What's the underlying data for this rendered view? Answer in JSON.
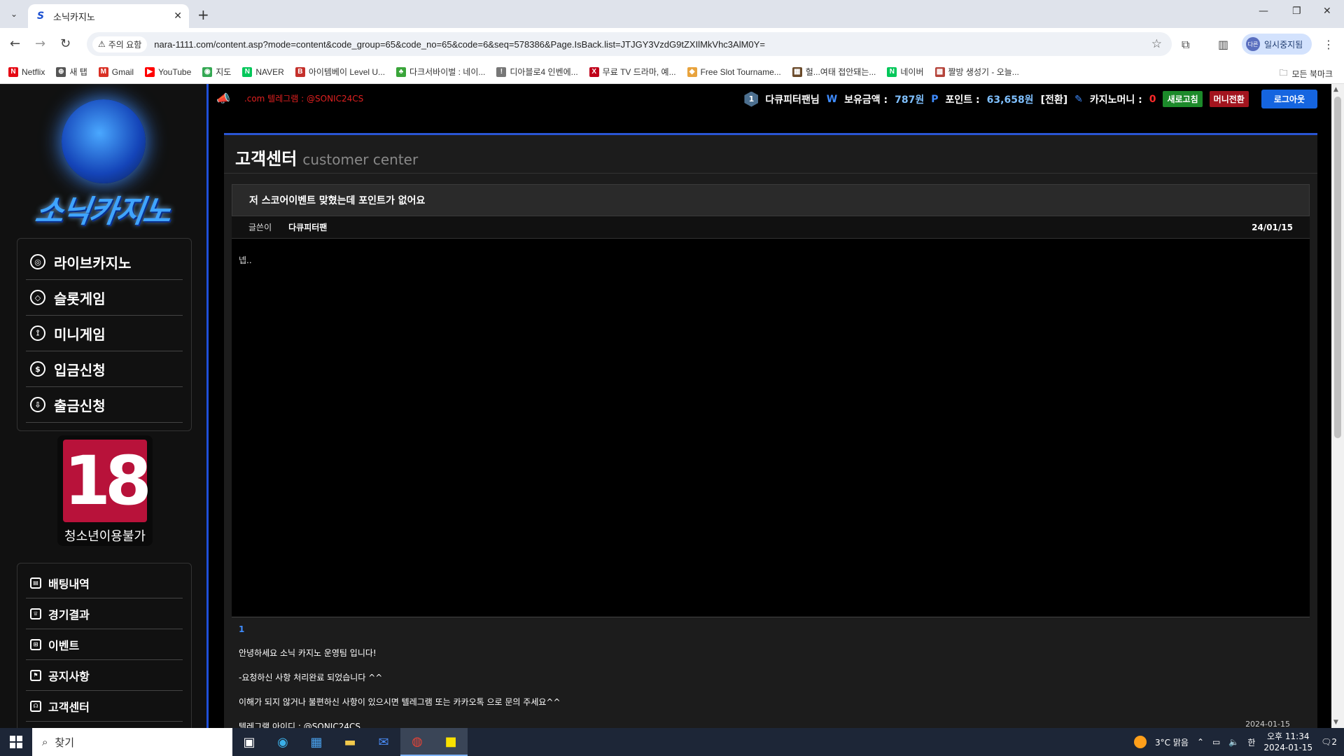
{
  "browser": {
    "tab_title": "소닉카지노",
    "tab_favicon": "S",
    "omnibox_warning": "주의 요함",
    "url": "nara-1111.com/content.asp?mode=content&code_group=65&code_no=65&code=6&seq=578386&Page.IsBack.list=JTJGY3VzdG9tZXIlMkVhc3AlM0Y=",
    "profile_label": "일시중지됨",
    "profile_avatar": "다른",
    "bookmarks": [
      {
        "label": "Netflix",
        "icon": "N",
        "color": "#e50914"
      },
      {
        "label": "새 탭",
        "icon": "⊕",
        "color": "#555"
      },
      {
        "label": "Gmail",
        "icon": "M",
        "color": "#d93025"
      },
      {
        "label": "YouTube",
        "icon": "▶",
        "color": "#ff0000"
      },
      {
        "label": "지도",
        "icon": "◉",
        "color": "#34a853"
      },
      {
        "label": "NAVER",
        "icon": "N",
        "color": "#03c75a"
      },
      {
        "label": "아이템베이 Level U...",
        "icon": "B",
        "color": "#c4302b"
      },
      {
        "label": "다크서바이벌 : 네이...",
        "icon": "♣",
        "color": "#3aa53a"
      },
      {
        "label": "디아블로4 인벤에...",
        "icon": "!",
        "color": "#777"
      },
      {
        "label": "무료 TV 드라마, 예...",
        "icon": "X",
        "color": "#c0001a"
      },
      {
        "label": "Free Slot Tourname...",
        "icon": "◆",
        "color": "#e8a33d"
      },
      {
        "label": "헐...여태 접안돼는...",
        "icon": "▦",
        "color": "#6a4a2a"
      },
      {
        "label": "네이버",
        "icon": "N",
        "color": "#03c75a"
      },
      {
        "label": "짤방 생성기 - 오늘...",
        "icon": "▩",
        "color": "#b5443b"
      }
    ],
    "all_bookmarks": "모든 북마크"
  },
  "site": {
    "logo_text": "소닉카지노",
    "marquee": ".com 텔레그램 : @SONIC24CS",
    "user": {
      "level": "1",
      "name": "다큐피터팬님",
      "balance_label": "보유금액 :",
      "balance_value": "787원",
      "points_label": "포인트 :",
      "points_value": "63,658원",
      "points_convert": "[전환]",
      "casino_label": "카지노머니 :",
      "casino_value": "0",
      "refresh_btn": "새로고침",
      "money_btn": "머니전환",
      "logout_btn": "로그아웃"
    },
    "main_menu": [
      {
        "label": "라이브카지노",
        "icon": "chip"
      },
      {
        "label": "슬롯게임",
        "icon": "diamond"
      },
      {
        "label": "미니게임",
        "icon": "joystick"
      },
      {
        "label": "입금신청",
        "icon": "coin"
      },
      {
        "label": "출금신청",
        "icon": "download"
      }
    ],
    "age_badge": {
      "number": "18",
      "label": "청소년이용불가"
    },
    "sub_menu": [
      {
        "label": "배팅내역"
      },
      {
        "label": "경기결과"
      },
      {
        "label": "이벤트"
      },
      {
        "label": "공지사항"
      },
      {
        "label": "고객센터"
      }
    ]
  },
  "content": {
    "title_ko": "고객센터",
    "title_en": "customer center",
    "post": {
      "title": "저 스코어이벤트 맞혔는데 포인트가 없어요",
      "author_label": "글쓴이",
      "author": "다큐피터팬",
      "date": "24/01/15",
      "body": "넵.."
    },
    "reply": {
      "number": "1",
      "lines": [
        "안녕하세요 소닉 카지노 운영팀 입니다!",
        "-요청하신 사항 처리완료 되었습니다 ^^",
        "이해가 되지 않거나 불편하신 사항이 있으시면 텔레그램 또는 카카오톡 으로 문의 주세요^^",
        "텔레그램 아이디 : @SONIC24CS"
      ],
      "date": "2024-01-15"
    }
  },
  "taskbar": {
    "search_placeholder": "찾기",
    "weather": "3°C 맑음",
    "time": "오후 11:34",
    "date": "2024-01-15",
    "notifications": "2"
  }
}
